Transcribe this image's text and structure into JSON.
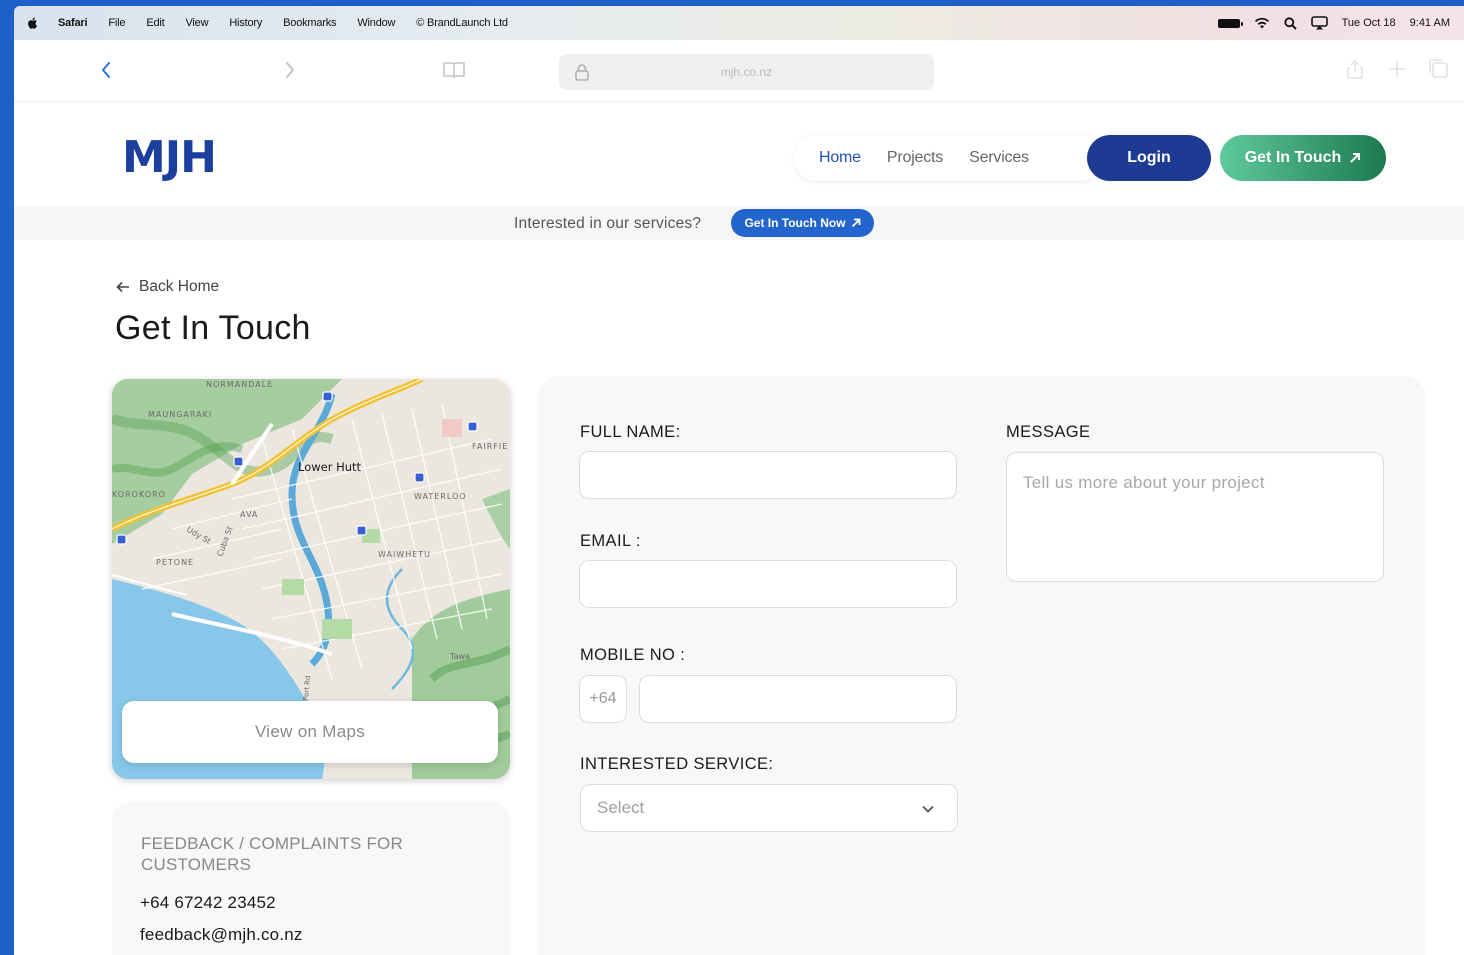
{
  "menubar": {
    "items": [
      "Safari",
      "File",
      "Edit",
      "View",
      "History",
      "Bookmarks",
      "Window",
      "© BrandLaunch Ltd"
    ],
    "date": "Tue Oct 18",
    "time": "9:41 AM"
  },
  "browser": {
    "url": "mjh.co.nz"
  },
  "site": {
    "logo": "MJH",
    "nav": [
      "Home",
      "Projects",
      "Services"
    ],
    "login_label": "Login",
    "get_in_touch_label": "Get In Touch"
  },
  "banner": {
    "text": "Interested in our services?",
    "button_label": "Get In Touch Now"
  },
  "main": {
    "back_label": "Back Home",
    "title": "Get In Touch",
    "map": {
      "view_button": "View on Maps",
      "labels": [
        "NORMANDALE",
        "MAUNGARAKI",
        "Lower Hutt",
        "FAIRFIE",
        "WATERLOO",
        "AVA",
        "Udy St",
        "Cuba St",
        "PETONE",
        "WAIWHETU",
        "KOROKORO",
        "Tawa",
        "Port Rd"
      ]
    },
    "feedback": {
      "heading": "FEEDBACK / COMPLAINTS FOR CUSTOMERS",
      "phone": "+64 67242 23452",
      "email": "feedback@mjh.co.nz"
    }
  },
  "form": {
    "full_name_label": "FULL NAME:",
    "email_label": "EMAIL :",
    "mobile_label": "MOBILE NO :",
    "mobile_prefix": "+64",
    "service_label": "INTERESTED SERVICE:",
    "service_selected": "Select",
    "message_label": "MESSAGE",
    "message_placeholder": "Tell us more about your project"
  },
  "colors": {
    "brand_blue": "#1e3b94",
    "accent_blue": "#2365cc",
    "green_start": "#5ec99d",
    "green_end": "#1d7a4e"
  }
}
